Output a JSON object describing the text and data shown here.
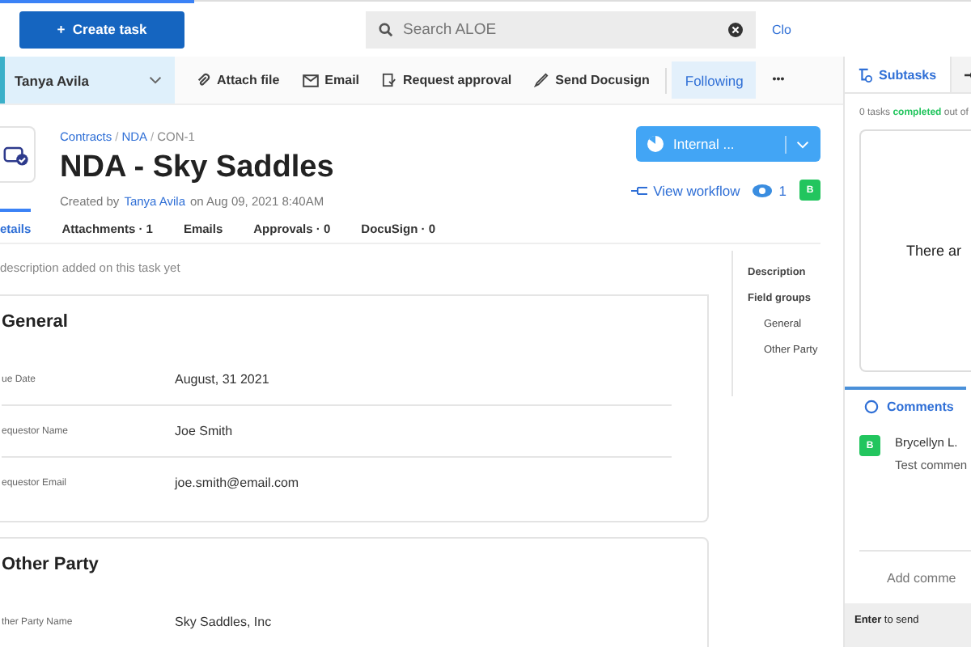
{
  "top_bar": {
    "progress": {
      "level": 0.2
    },
    "create_button": {
      "icon": "+",
      "label": "Create task"
    },
    "search": {
      "placeholder": "Search ALOE"
    },
    "close_link": "Clo"
  },
  "toolbar": {
    "assignee": "Tanya Avila",
    "actions": [
      {
        "kind": "attach",
        "label": "Attach file"
      },
      {
        "kind": "email",
        "label": "Email"
      },
      {
        "kind": "approval",
        "label": "Request approval"
      },
      {
        "kind": "docusign",
        "label": "Send Docusign"
      }
    ],
    "following": {
      "label": "Following",
      "on": true
    },
    "more": "•••"
  },
  "task": {
    "breadcrumb": [
      "Contracts",
      "NDA",
      "CON-1"
    ],
    "breadcrumb_separator": "/",
    "title": "NDA - Sky Saddles",
    "created_prefix": "Created by",
    "creator": "Tanya Avila",
    "created_suffix": "on Aug 09, 2021 8:40AM",
    "status": "Internal ...",
    "workflow_link": "View workflow",
    "watchers": "1",
    "avatar": "B"
  },
  "tabs": [
    {
      "label": "etails",
      "selected": true
    },
    {
      "label": "Attachments · 1",
      "selected": false
    },
    {
      "label": "Emails",
      "selected": false
    },
    {
      "label": "Approvals · 0",
      "selected": false
    },
    {
      "label": "DocuSign · 0",
      "selected": false
    }
  ],
  "description": "description added on this task yet",
  "field_groups": [
    {
      "title": "General",
      "fields": [
        {
          "label": "ue Date",
          "value": "August, 31 2021"
        },
        {
          "label": "equestor Name",
          "value": "Joe Smith"
        },
        {
          "label": "equestor Email",
          "value": "joe.smith@email.com"
        }
      ]
    },
    {
      "title": "Other Party",
      "fields": [
        {
          "label": "ther Party Name",
          "value": "Sky Saddles, Inc"
        }
      ]
    }
  ],
  "page_nav": [
    {
      "label": "Description"
    },
    {
      "label": "Field groups",
      "children": [
        {
          "label": "General"
        },
        {
          "label": "Other Party"
        }
      ]
    }
  ],
  "side_panel": {
    "tabs": [
      {
        "kind": "subtasks",
        "label": "Subtasks",
        "selected": true
      },
      {
        "kind": "icon",
        "selected": false
      }
    ],
    "summary_count": "0 tasks",
    "summary_status": "completed",
    "summary_rest": "out of",
    "empty_text": "There ar",
    "comments_tab": "Comments",
    "comments": [
      {
        "avatar": "B",
        "author": "Brycellyn L.",
        "text": "Test commen"
      }
    ],
    "comment_input": {
      "placeholder": "Add comme"
    },
    "hint": "**Enter** to send"
  }
}
